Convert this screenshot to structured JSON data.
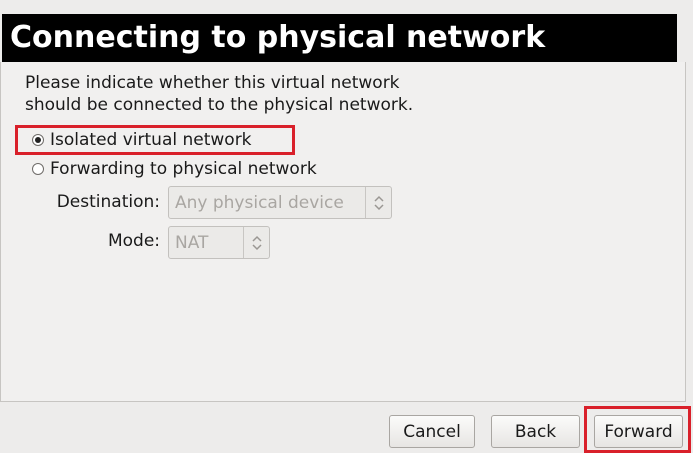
{
  "header": {
    "title": "Connecting to physical network"
  },
  "description": {
    "line1": "Please indicate whether this virtual network",
    "line2": "should be connected to the physical network."
  },
  "options": {
    "isolated": {
      "label": "Isolated virtual network",
      "selected": true
    },
    "forwarding": {
      "label": "Forwarding to physical network",
      "selected": false
    }
  },
  "destination": {
    "label": "Destination:",
    "value": "Any physical device"
  },
  "mode": {
    "label": "Mode:",
    "value": "NAT"
  },
  "buttons": {
    "cancel": "Cancel",
    "back": "Back",
    "forward": "Forward"
  },
  "colors": {
    "highlight": "#d9202a",
    "banner_bg": "#000000",
    "banner_text": "#ffffff"
  }
}
